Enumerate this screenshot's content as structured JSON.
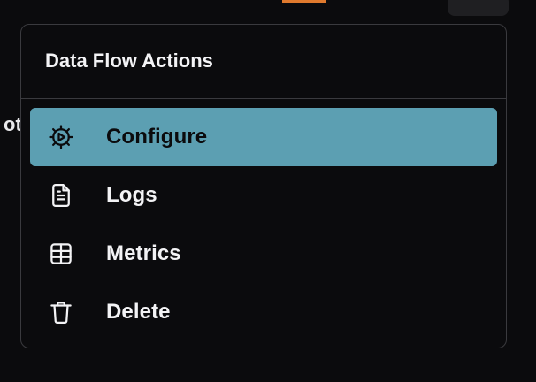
{
  "background": {
    "fragment_text": "ot",
    "accent_color": "#e07a2e"
  },
  "menu": {
    "title": "Data Flow Actions",
    "active_color": "#5c9fb2",
    "items": [
      {
        "label": "Configure",
        "icon": "gear-play-icon",
        "active": true
      },
      {
        "label": "Logs",
        "icon": "document-icon",
        "active": false
      },
      {
        "label": "Metrics",
        "icon": "table-icon",
        "active": false
      },
      {
        "label": "Delete",
        "icon": "trash-icon",
        "active": false
      }
    ]
  }
}
